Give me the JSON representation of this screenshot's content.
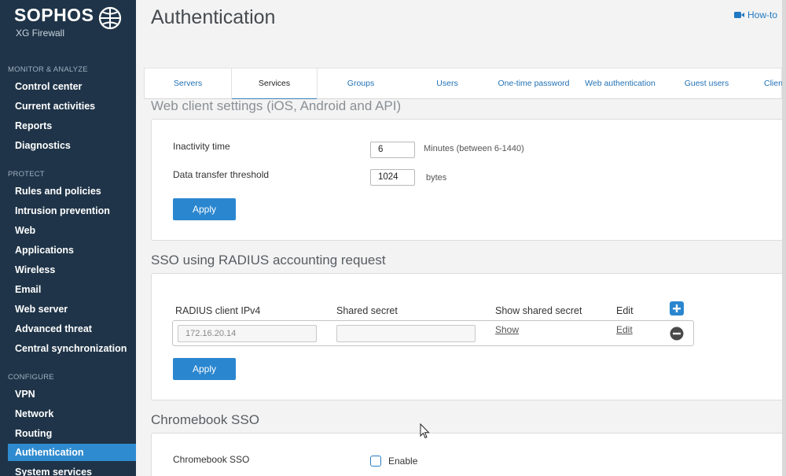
{
  "brand": {
    "name": "SOPHOS",
    "product": "XG Firewall"
  },
  "sidebar": {
    "sections": [
      {
        "title": "MONITOR & ANALYZE",
        "items": [
          "Control center",
          "Current activities",
          "Reports",
          "Diagnostics"
        ]
      },
      {
        "title": "PROTECT",
        "items": [
          "Rules and policies",
          "Intrusion prevention",
          "Web",
          "Applications",
          "Wireless",
          "Email",
          "Web server",
          "Advanced threat",
          "Central synchronization"
        ]
      },
      {
        "title": "CONFIGURE",
        "items": [
          "VPN",
          "Network",
          "Routing",
          "Authentication",
          "System services"
        ]
      }
    ],
    "active_item": "Authentication"
  },
  "header": {
    "title": "Authentication",
    "howto_label": "How-to"
  },
  "tabs": [
    "Servers",
    "Services",
    "Groups",
    "Users",
    "One-time password",
    "Web authentication",
    "Guest users",
    "Client"
  ],
  "active_tab": "Services",
  "web_client": {
    "title": "Web client settings (iOS, Android and API)",
    "inactivity_label": "Inactivity time",
    "inactivity_value": "6",
    "inactivity_hint": "Minutes (between 6-1440)",
    "threshold_label": "Data transfer threshold",
    "threshold_value": "1024",
    "threshold_hint": "bytes",
    "apply_label": "Apply"
  },
  "radius": {
    "title": "SSO using RADIUS accounting request",
    "columns": [
      "RADIUS client IPv4",
      "Shared secret",
      "Show shared secret",
      "Edit"
    ],
    "rows": [
      {
        "ip_placeholder": "172.16.20.14",
        "secret": "",
        "show_label": "Show",
        "edit_label": "Edit"
      }
    ],
    "apply_label": "Apply"
  },
  "chromebook": {
    "title": "Chromebook SSO",
    "label": "Chromebook SSO",
    "enable_label": "Enable",
    "enabled": false
  },
  "colors": {
    "sidebar_bg": "#1f3448",
    "accent": "#2a86cf",
    "link": "#2272b5"
  }
}
